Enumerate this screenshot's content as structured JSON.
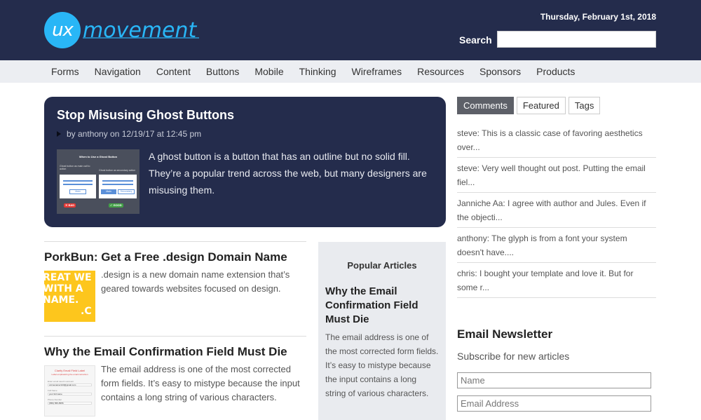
{
  "header": {
    "logo_mark": "ux",
    "logo_word": "movement",
    "date": "Thursday, February 1st, 2018",
    "search_label": "Search",
    "search_value": ""
  },
  "nav": [
    "Forms",
    "Navigation",
    "Content",
    "Buttons",
    "Mobile",
    "Thinking",
    "Wireframes",
    "Resources",
    "Sponsors",
    "Products"
  ],
  "feature": {
    "title": "Stop Misusing Ghost Buttons",
    "meta": "by anthony on 12/19/17 at 12:45 pm",
    "excerpt": "A ghost button is a button that has an outline but no solid fill. They’re a popular trend across the web, but many designers are misusing them.",
    "thumb": {
      "title": "When to Use a Ghost Button",
      "left_caption": "Ghost button as main call to action",
      "right_caption": "Ghost button as secondary action",
      "left_btn": "Main",
      "right_btn1": "Main",
      "right_btn2": "Secondary",
      "bad": "✕ BAD",
      "good": "✓ GOOD"
    }
  },
  "articles": [
    {
      "title": "PorkBun: Get a Free .design Domain Name",
      "excerpt": ".design is a new domain name extension that’s geared towards websites focused on design.",
      "thumb_lines": [
        "REAT WE",
        "WITH A",
        "NAME.",
        ".C"
      ]
    },
    {
      "title": "Why the Email Confirmation Field Must Die",
      "excerpt": "The email address is one of the most corrected form fields. It’s easy to mistype because the input contains a long string of various characters.",
      "thumb": {
        "title": "Clarify Email Field Label",
        "subtitle": "Label emphasizing the email correction",
        "label1": "Enter email used in account",
        "value1": "unimenamer123@gmail.com",
        "label2": "Full Name",
        "value2": "your full name",
        "label3": "Phone Number",
        "value3": "(555) 555-5555"
      }
    }
  ],
  "popular": {
    "heading": "Popular Articles",
    "title": "Why the Email Confirmation Field Must Die",
    "excerpt": "The email address is one of the most corrected form fields. It’s easy to mistype because the input contains a long string of various characters."
  },
  "sidebar": {
    "tabs": [
      "Comments",
      "Featured",
      "Tags"
    ],
    "comments": [
      "steve: This is a classic case of favoring aesthetics over...",
      "steve: Very well thought out post. Putting the email fiel...",
      "Janniche Aa: I agree with author and Jules. Even if the objecti...",
      "anthony: The glyph is from a font your system doesn't have....",
      "chris: I bought your template and love it. But for some r..."
    ],
    "newsletter": {
      "title": "Email Newsletter",
      "subtitle": "Subscribe for new articles",
      "name_placeholder": "Name",
      "email_placeholder": "Email Address"
    }
  },
  "colors": {
    "header_bg": "#242c4c",
    "accent": "#29b6f6",
    "nav_bg": "#eceef2",
    "popular_bg": "#e9ebef"
  }
}
